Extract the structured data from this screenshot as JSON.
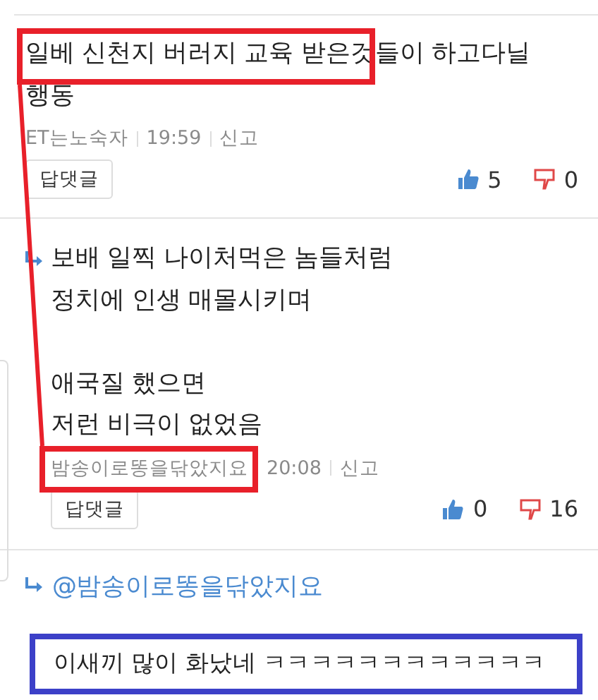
{
  "comments": [
    {
      "kind": "comment",
      "text": "일베 신천지 버러지 교육 받은것들이 하고다닐 행동",
      "author": "ET는노숙자",
      "time": "19:59",
      "report": "신고",
      "reply_button": "답댓글",
      "likes": "5",
      "dislikes": "0"
    },
    {
      "kind": "reply",
      "text": "보배 일찍 나이처먹은 놈들처럼\n정치에 인생 매몰시키며\n\n애국질 했으면\n저런 비극이 없었음",
      "author": "밤송이로똥을닦았지요",
      "time": "20:08",
      "report": "신고",
      "reply_button": "답댓글",
      "likes": "0",
      "dislikes": "16"
    }
  ],
  "reply_target": "@밤송이로똥을닦았지요",
  "draft": "이새끼 많이 화났네 ㅋㅋㅋㅋㅋㅋㅋㅋㅋㅋㅋㅋ",
  "annotations": [
    {
      "kind": "box",
      "color": "#e8202a"
    },
    {
      "kind": "line",
      "color": "#e8202a"
    },
    {
      "kind": "box",
      "color": "#e8202a"
    },
    {
      "kind": "box",
      "color": "#3c40c8"
    }
  ]
}
